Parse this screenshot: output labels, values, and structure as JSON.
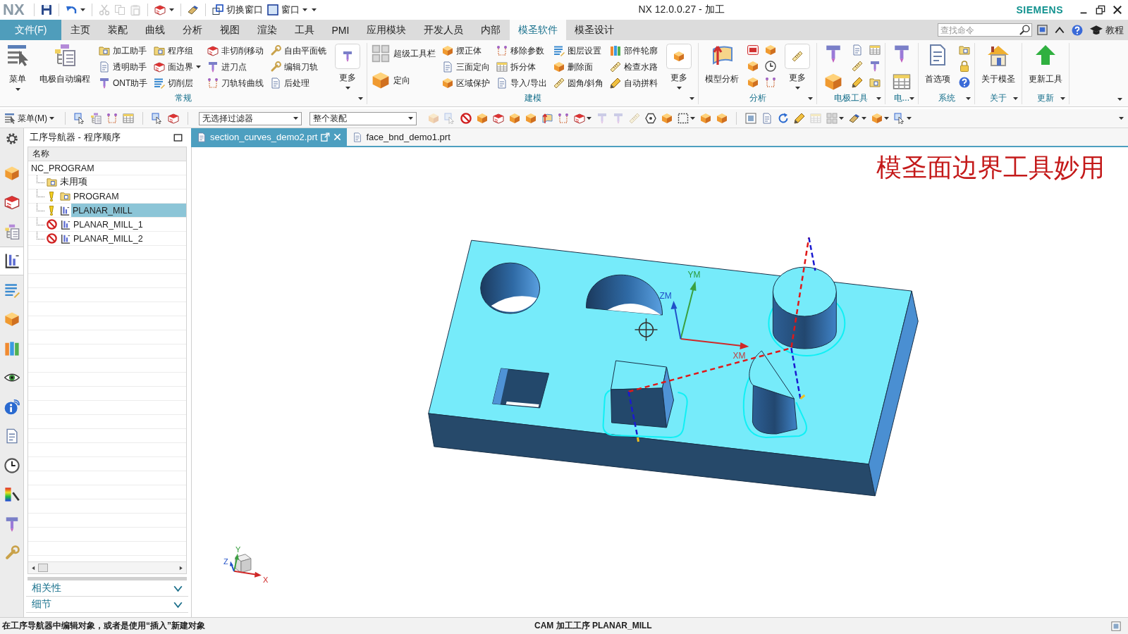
{
  "title_bar": {
    "logo": "NX",
    "quick_access": [
      {
        "disabled": false,
        "dropdown": false
      },
      {
        "disabled": false,
        "dropdown": true
      },
      {
        "disabled": true,
        "dropdown": false
      },
      {
        "disabled": true,
        "dropdown": false
      },
      {
        "disabled": true,
        "dropdown": false
      },
      {
        "disabled": false,
        "dropdown": true
      },
      {
        "disabled": false,
        "dropdown": false
      }
    ],
    "window_buttons": [
      {
        "label": "切换窗口",
        "dropdown": false
      },
      {
        "label": "窗口",
        "dropdown": true
      }
    ],
    "title": "NX 12.0.0.27 - 加工",
    "brand": "SIEMENS"
  },
  "menu_tabs": [
    {
      "label": "文件(F)",
      "kind": "file",
      "selected": false
    },
    {
      "label": "主页",
      "kind": "tab",
      "selected": false
    },
    {
      "label": "装配",
      "kind": "tab",
      "selected": false
    },
    {
      "label": "曲线",
      "kind": "tab",
      "selected": false
    },
    {
      "label": "分析",
      "kind": "tab",
      "selected": false
    },
    {
      "label": "视图",
      "kind": "tab",
      "selected": false
    },
    {
      "label": "渲染",
      "kind": "tab",
      "selected": false
    },
    {
      "label": "工具",
      "kind": "tab",
      "selected": false
    },
    {
      "label": "PMI",
      "kind": "tab",
      "selected": false
    },
    {
      "label": "应用模块",
      "kind": "tab",
      "selected": false
    },
    {
      "label": "开发人员",
      "kind": "tab",
      "selected": false
    },
    {
      "label": "内部",
      "kind": "tab",
      "selected": false
    },
    {
      "label": "模圣软件",
      "kind": "tab",
      "selected": true
    },
    {
      "label": "模圣设计",
      "kind": "tab",
      "selected": false
    }
  ],
  "command_search": {
    "placeholder": "查找命令"
  },
  "tutorial": "教程",
  "ribbon_groups": [
    {
      "label": "常规",
      "items": [
        {
          "kind": "large",
          "label": "菜单",
          "dropdown": true
        },
        {
          "kind": "large",
          "label": "电极自动编程",
          "dropdown": false
        },
        {
          "kind": "stack",
          "rows": [
            {
              "label": "加工助手",
              "dropdown": false
            },
            {
              "label": "透明助手",
              "dropdown": false
            },
            {
              "label": "ONT助手",
              "dropdown": false
            }
          ]
        },
        {
          "kind": "stack",
          "rows": [
            {
              "label": "程序组",
              "dropdown": false
            },
            {
              "label": "面边界",
              "dropdown": true
            },
            {
              "label": "切削层",
              "dropdown": false
            }
          ]
        },
        {
          "kind": "stack",
          "rows": [
            {
              "label": "非切削移动",
              "dropdown": false
            },
            {
              "label": "进刀点",
              "dropdown": false
            },
            {
              "label": "刀轨转曲线",
              "dropdown": false
            }
          ]
        },
        {
          "kind": "stack",
          "rows": [
            {
              "label": "自由平面铣",
              "dropdown": false
            },
            {
              "label": "编辑刀轨",
              "dropdown": false
            },
            {
              "label": "后处理",
              "dropdown": false
            }
          ]
        },
        {
          "kind": "more",
          "label": "更多",
          "dropdown": true
        }
      ]
    },
    {
      "label": "建模",
      "items": [
        {
          "kind": "medium_stack",
          "rows": [
            {
              "label": "超级工具栏",
              "dropdown": false
            },
            {
              "label": "定向",
              "dropdown": false
            }
          ]
        },
        {
          "kind": "stack",
          "rows": [
            {
              "label": "摆正体",
              "dropdown": false
            },
            {
              "label": "三面定向",
              "dropdown": false
            },
            {
              "label": "区域保护",
              "dropdown": false
            }
          ]
        },
        {
          "kind": "stack",
          "rows": [
            {
              "label": "移除参数",
              "dropdown": false
            },
            {
              "label": "拆分体",
              "dropdown": false
            },
            {
              "label": "导入/导出",
              "dropdown": false
            }
          ]
        },
        {
          "kind": "stack",
          "rows": [
            {
              "label": "图层设置",
              "dropdown": false
            },
            {
              "label": "删除面",
              "dropdown": false
            },
            {
              "label": "圆角/斜角",
              "dropdown": false
            }
          ]
        },
        {
          "kind": "stack",
          "rows": [
            {
              "label": "部件轮廓",
              "dropdown": false
            },
            {
              "label": "检查水路",
              "dropdown": false
            },
            {
              "label": "自动拼料",
              "dropdown": false
            }
          ]
        },
        {
          "kind": "more",
          "label": "更多",
          "dropdown": true
        }
      ]
    },
    {
      "label": "分析",
      "items": [
        {
          "kind": "large",
          "label": "模型分析",
          "dropdown": false
        },
        {
          "kind": "icon_stack"
        },
        {
          "kind": "icon_stack"
        },
        {
          "kind": "more",
          "label": "更多",
          "dropdown": true
        }
      ]
    },
    {
      "label": "电极工具",
      "items": [
        {
          "kind": "icon_pair"
        },
        {
          "kind": "icon_stack"
        },
        {
          "kind": "icon_stack"
        }
      ]
    },
    {
      "label": "电...",
      "items": [
        {
          "kind": "icon_pair"
        }
      ]
    },
    {
      "label": "系统",
      "items": [
        {
          "kind": "large",
          "label": "首选项",
          "dropdown": false
        },
        {
          "kind": "icon_stack"
        }
      ]
    },
    {
      "label": "关于",
      "items": [
        {
          "kind": "large",
          "label": "关于模圣",
          "dropdown": false
        }
      ]
    },
    {
      "label": "更新",
      "items": [
        {
          "kind": "large",
          "label": "更新工具",
          "dropdown": false
        }
      ]
    }
  ],
  "toolbar": {
    "menu_button": "菜单(M)",
    "icons_before": [
      {
        "disabled": false,
        "dropdown": false
      },
      {
        "disabled": false,
        "dropdown": false
      },
      {
        "disabled": false,
        "dropdown": false
      },
      {
        "disabled": false,
        "dropdown": false
      },
      {
        "disabled": false,
        "dropdown": false
      },
      {
        "disabled": false,
        "dropdown": false
      }
    ],
    "selection_filter": "无选择过滤器",
    "scope": "整个装配",
    "icons_after": [
      {
        "disabled": true,
        "dropdown": false
      },
      {
        "disabled": true,
        "dropdown": false
      },
      {
        "disabled": false,
        "dropdown": false
      },
      {
        "disabled": false,
        "dropdown": false
      },
      {
        "disabled": false,
        "dropdown": false
      },
      {
        "disabled": false,
        "dropdown": false
      },
      {
        "disabled": false,
        "dropdown": false
      },
      {
        "disabled": false,
        "dropdown": false
      },
      {
        "disabled": false,
        "dropdown": false
      },
      {
        "disabled": false,
        "dropdown": true
      },
      {
        "disabled": true,
        "dropdown": false
      },
      {
        "disabled": true,
        "dropdown": false
      },
      {
        "disabled": true,
        "dropdown": false
      },
      {
        "disabled": false,
        "dropdown": false
      },
      {
        "disabled": false,
        "dropdown": false
      },
      {
        "disabled": false,
        "dropdown": true
      },
      {
        "disabled": false,
        "dropdown": false
      },
      {
        "disabled": false,
        "dropdown": false
      },
      {
        "disabled": false,
        "dropdown": false
      },
      {
        "disabled": false,
        "dropdown": false
      },
      {
        "disabled": false,
        "dropdown": false
      },
      {
        "disabled": false,
        "dropdown": false
      },
      {
        "disabled": true,
        "dropdown": false
      },
      {
        "disabled": false,
        "dropdown": true
      },
      {
        "disabled": false,
        "dropdown": true
      },
      {
        "disabled": false,
        "dropdown": true
      },
      {
        "disabled": false,
        "dropdown": true
      }
    ]
  },
  "rail_icons": [
    {
      "selected": false
    },
    {
      "selected": false
    },
    {
      "selected": false
    },
    {
      "selected": false
    },
    {
      "selected": true
    },
    {
      "selected": false
    },
    {
      "selected": false
    },
    {
      "selected": false
    },
    {
      "selected": false
    },
    {
      "selected": false
    },
    {
      "selected": false
    },
    {
      "selected": false
    },
    {
      "selected": false
    },
    {
      "selected": false
    },
    {
      "selected": false
    }
  ],
  "navigator": {
    "title": "工序导航器 - 程序顺序",
    "column": "名称",
    "tree": [
      {
        "label": "NC_PROGRAM",
        "warning": false,
        "error": false,
        "selected": false,
        "children": [
          {
            "label": "未用项",
            "kind": "group",
            "warning": false,
            "error": false,
            "selected": false
          },
          {
            "label": "PROGRAM",
            "kind": "group",
            "warning": true,
            "error": false,
            "selected": false
          },
          {
            "label": "PLANAR_MILL",
            "kind": "operation",
            "warning": true,
            "error": false,
            "selected": true
          },
          {
            "label": "PLANAR_MILL_1",
            "kind": "operation",
            "warning": false,
            "error": true,
            "selected": false
          },
          {
            "label": "PLANAR_MILL_2",
            "kind": "operation",
            "warning": false,
            "error": true,
            "selected": false
          }
        ]
      }
    ],
    "panels": [
      {
        "label": "相关性",
        "expanded": false
      },
      {
        "label": "细节",
        "expanded": false
      }
    ]
  },
  "document_tabs": [
    {
      "label": "section_curves_demo2.prt",
      "selected": true
    },
    {
      "label": "face_bnd_demo1.prt",
      "selected": false
    }
  ],
  "viewport": {
    "caption": "模圣面边界工具妙用",
    "csys": {
      "x": "XM",
      "y": "YM",
      "z": "ZM"
    },
    "triad": {
      "x": "X",
      "y": "Y",
      "z": "Z"
    }
  },
  "status_bar": {
    "message": "在工序导航器中编辑对象，或者是使用“插入”新建对象",
    "mode": "CAM 加工工序 PLANAR_MILL"
  }
}
